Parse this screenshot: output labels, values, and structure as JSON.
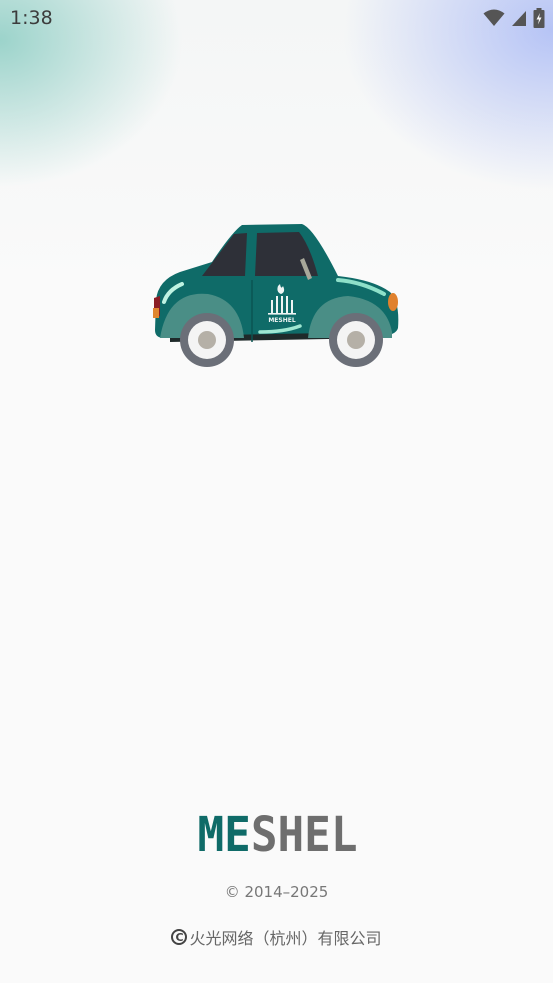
{
  "status_bar": {
    "time": "1:38",
    "icons": [
      "wifi-icon",
      "cellular-signal-icon",
      "battery-charging-icon"
    ]
  },
  "splash": {
    "illustration": "car-illustration",
    "door_logo_text": "MESHEL",
    "brand_logo_text": "MESHEL",
    "copyright": "© 2014–2025",
    "company": "火光网络（杭州）有限公司",
    "company_mark": "C"
  },
  "colors": {
    "brand_teal": "#0f6b68",
    "brand_gray": "#6e6e6e",
    "tire": "#6b6f78",
    "window": "#2e3038"
  }
}
